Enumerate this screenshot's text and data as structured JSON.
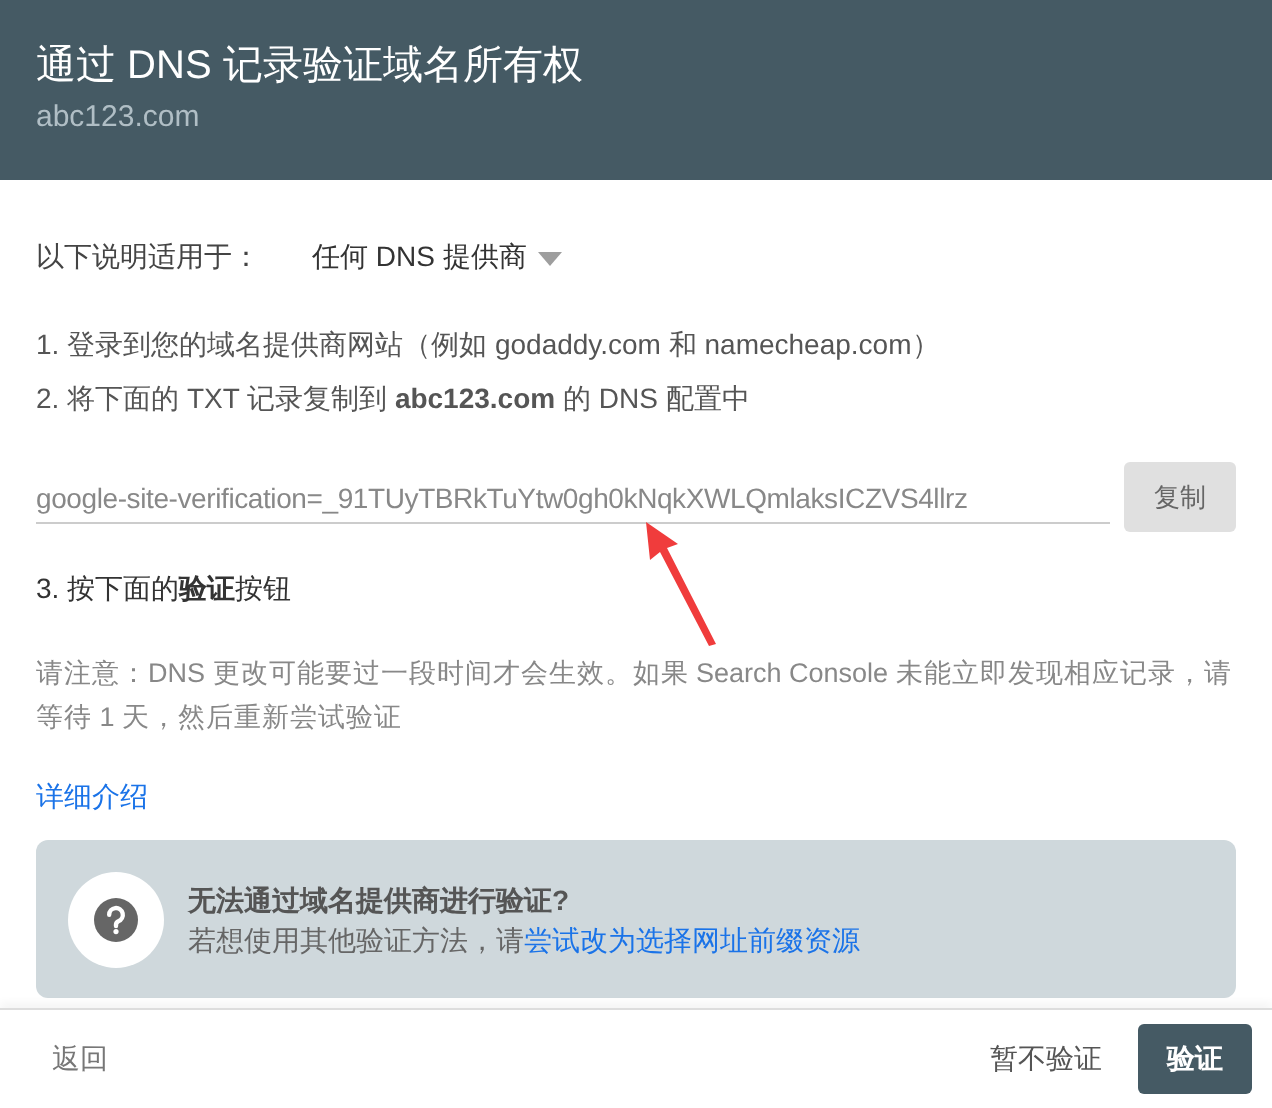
{
  "header": {
    "title": "通过 DNS 记录验证域名所有权",
    "subtitle": "abc123.com"
  },
  "applies_to": {
    "label": "以下说明适用于：",
    "value": "任何 DNS 提供商"
  },
  "steps": [
    "1. 登录到您的域名提供商网站（例如 godaddy.com 和 namecheap.com）",
    "2. 将下面的 TXT 记录复制到 **abc123.com** 的 DNS 配置中"
  ],
  "txt_record": {
    "value": "google-site-verification=_91TUyTBRkTuYtw0gh0kNqkXWLQmlaksICZVS4llrz",
    "copy_button": "复制"
  },
  "step_3": "3. 按下面的**验证**按钮",
  "note": "请注意：DNS 更改可能要过一段时间才会生效。如果 Search Console 未能立即发现相应记录，请等待 1 天，然后重新尝试验证",
  "details_link": "详细介绍",
  "help_box": {
    "title": "无法通过域名提供商进行验证?",
    "text": "若想使用其他验证方法，请",
    "link": "尝试改为选择网址前缀资源"
  },
  "annotation": {
    "kind": "arrow",
    "color": "#f03c3c"
  },
  "footer": {
    "back": "返回",
    "skip": "暂不验证",
    "verify": "验证"
  }
}
